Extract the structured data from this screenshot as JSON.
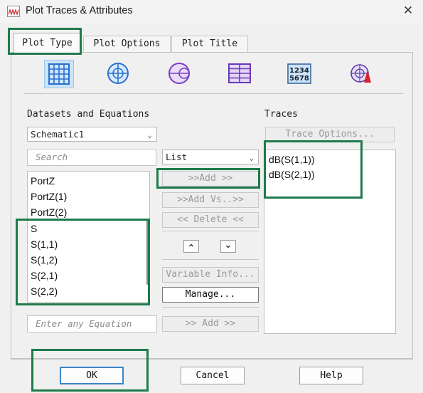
{
  "window": {
    "title": "Plot Traces & Attributes",
    "close_glyph": "✕"
  },
  "tabs": [
    {
      "label": "Plot Type"
    },
    {
      "label": "Plot Options"
    },
    {
      "label": "Plot Title"
    }
  ],
  "plot_type_icons": [
    "rectangular-plot-icon",
    "polar-plot-icon",
    "smith-chart-icon",
    "table-icon",
    "list-numeric-icon",
    "antenna-plot-icon"
  ],
  "numeric_icon_text": [
    "1234",
    "5678"
  ],
  "datasets": {
    "label": "Datasets and Equations",
    "selected_dataset": "Schematic1",
    "search_placeholder": "Search",
    "mode_select": "List",
    "items": [
      "PortZ",
      "PortZ(1)",
      "PortZ(2)",
      "S",
      "S(1,1)",
      "S(1,2)",
      "S(2,1)",
      "S(2,2)"
    ],
    "equation_placeholder": "Enter any Equation"
  },
  "actions": {
    "add": ">>Add >>",
    "add_vs": ">>Add Vs..>>",
    "delete": "<< Delete <<",
    "up": "⌃",
    "down": "⌄",
    "variable_info": "Variable Info...",
    "manage": "Manage...",
    "add_equation": ">> Add >>"
  },
  "traces": {
    "label": "Traces",
    "trace_options": "Trace Options...",
    "items": [
      "dB(S(1,1))",
      "dB(S(2,1))"
    ]
  },
  "buttons": {
    "ok": "OK",
    "cancel": "Cancel",
    "help": "Help"
  },
  "colors": {
    "highlight": "#1e7b4b",
    "selected_icon_bg": "#cce4f7",
    "ok_focus": "#3a86c8"
  }
}
